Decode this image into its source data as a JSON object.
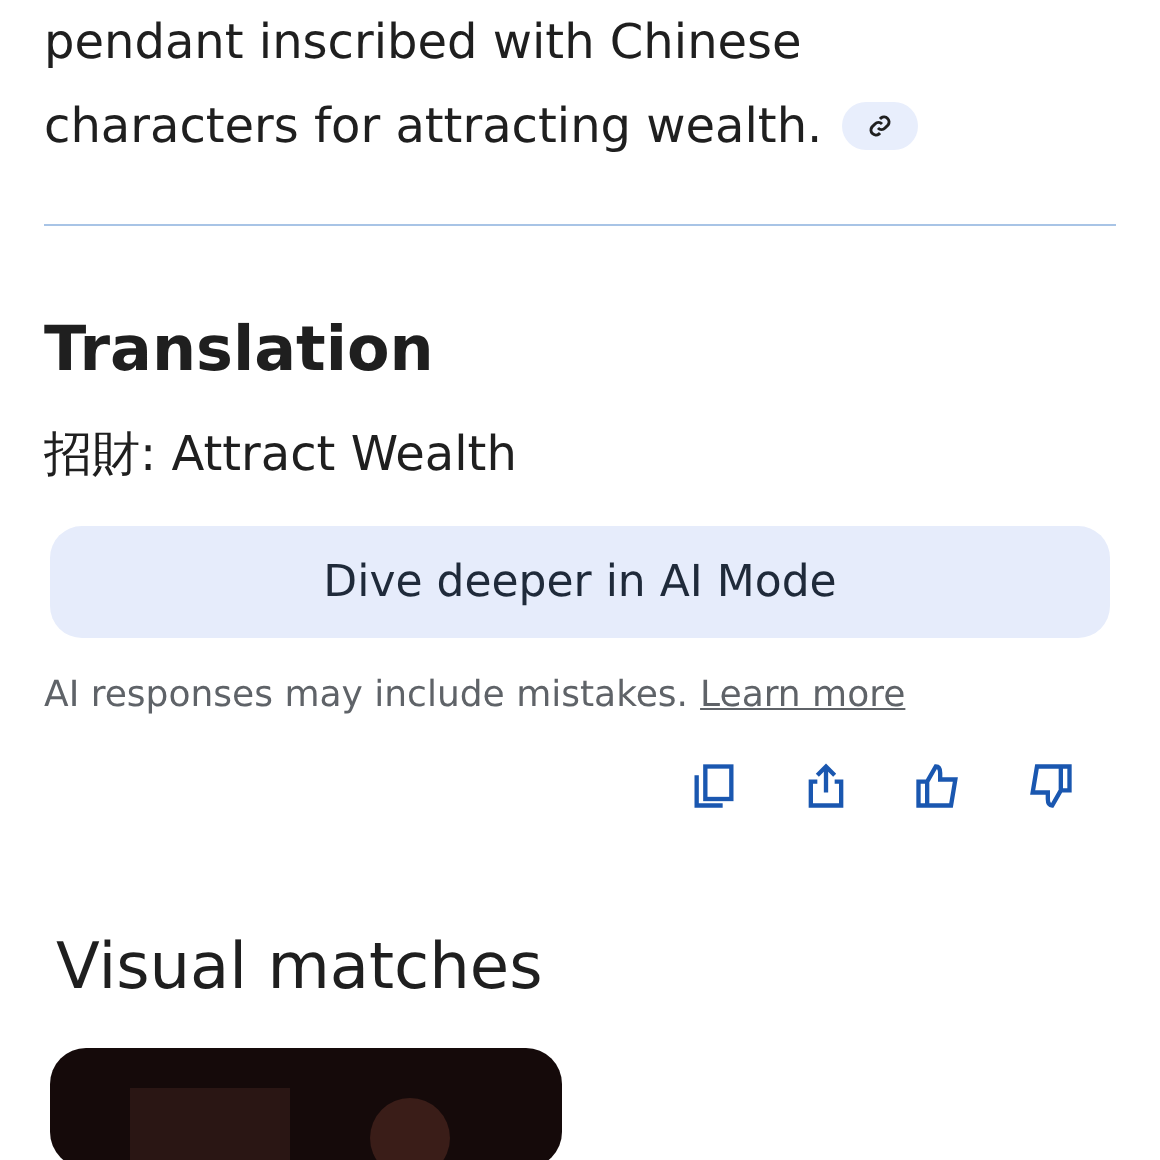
{
  "answer": {
    "lines": [
      "pendant inscribed with Chinese",
      "characters for attracting wealth."
    ]
  },
  "translation": {
    "heading": "Translation",
    "text": "招財: Attract Wealth"
  },
  "ai_mode_button": "Dive deeper in AI Mode",
  "disclaimer": {
    "text": "AI responses may include mistakes.",
    "link": "Learn more"
  },
  "actions": [
    {
      "kind": "copy"
    },
    {
      "kind": "share"
    },
    {
      "kind": "like"
    },
    {
      "kind": "dislike"
    }
  ],
  "visual_matches": {
    "heading": "Visual matches"
  }
}
